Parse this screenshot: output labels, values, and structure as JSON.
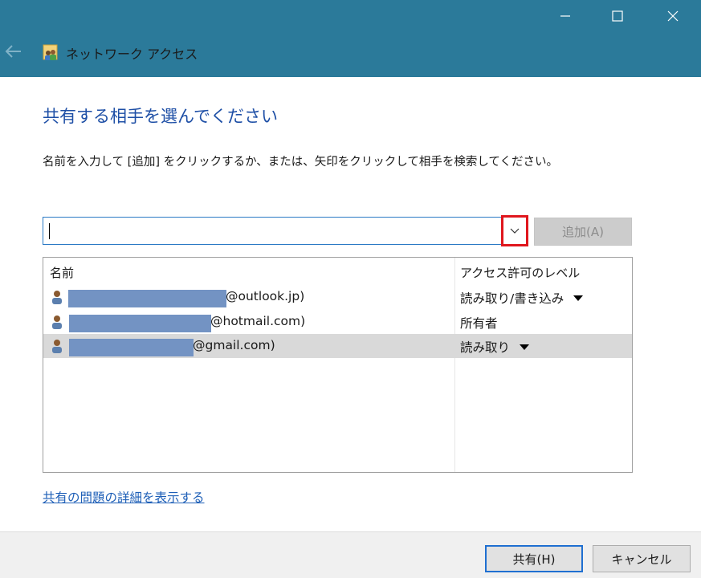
{
  "window": {
    "title": "ネットワーク アクセス",
    "controls": {
      "minimize": "minimize-icon",
      "maximize": "maximize-icon",
      "close": "close-icon"
    }
  },
  "heading": "共有する相手を選んでください",
  "instructions": "名前を入力して [追加] をクリックするか、または、矢印をクリックして相手を検索してください。",
  "input": {
    "value": "",
    "placeholder": ""
  },
  "add_button": "追加(A)",
  "list": {
    "columns": [
      "名前",
      "アクセス許可のレベル"
    ],
    "rows": [
      {
        "email": "@outlook.jp)",
        "level": "読み取り/書き込み",
        "has_dropdown": true,
        "selected": false
      },
      {
        "email": "@hotmail.com)",
        "level": "所有者",
        "has_dropdown": false,
        "selected": false
      },
      {
        "email": "@gmail.com)",
        "level": "読み取り",
        "has_dropdown": true,
        "selected": true
      }
    ]
  },
  "details_link": "共有の問題の詳細を表示する",
  "footer": {
    "share_button": "共有(H)",
    "cancel_button": "キャンセル"
  },
  "colors": {
    "titlebar": "#2b7a9a",
    "heading": "#1e4fa6",
    "link": "#1e5fb7",
    "highlight": "#e0161d",
    "redaction": "#7393c3"
  }
}
